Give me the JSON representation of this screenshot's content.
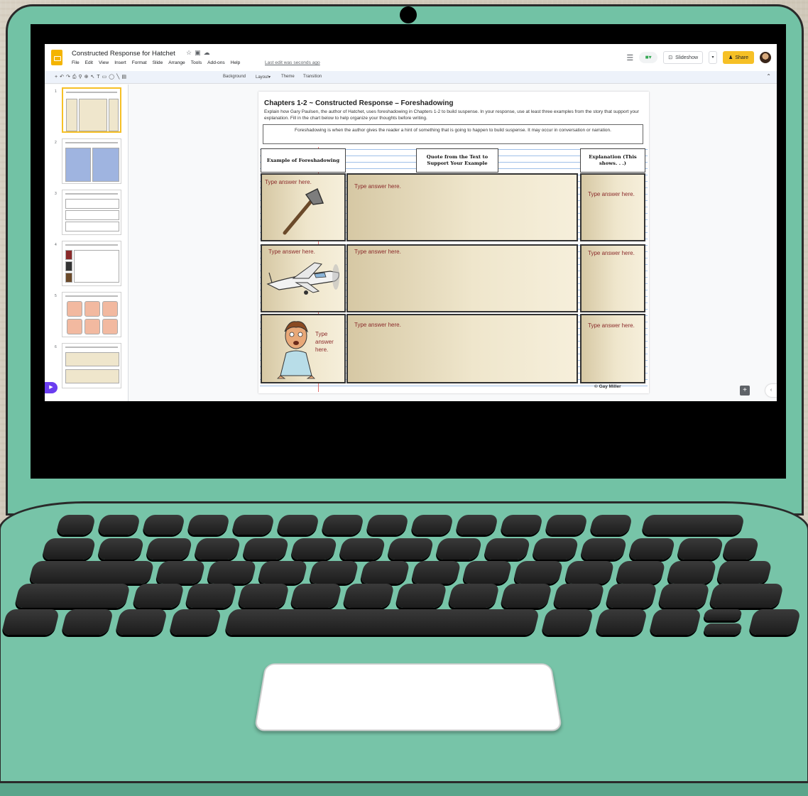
{
  "app": {
    "doc_title": "Constructed Response for Hatchet",
    "menus": [
      "File",
      "Edit",
      "View",
      "Insert",
      "Format",
      "Slide",
      "Arrange",
      "Tools",
      "Add-ons",
      "Help"
    ],
    "last_edit": "Last edit was seconds ago",
    "slideshow_label": "Slideshow",
    "share_label": "Share",
    "colors": {
      "brand": "#f4b400",
      "share": "#f6c026",
      "accent": "#6a3df0"
    }
  },
  "toolbar": {
    "background": "Background",
    "layout": "Layout▾",
    "theme": "Theme",
    "transition": "Transition"
  },
  "filmstrip": {
    "numbers": [
      "1",
      "2",
      "3",
      "4",
      "5",
      "6"
    ]
  },
  "slide": {
    "title": "Chapters 1-2 ~ Constructed Response – Foreshadowing",
    "instructions": "Explain how Gary Paulsen, the author of Hatchet, uses foreshadowing in Chapters 1-2 to build suspense. In your response, use at least three examples from the story that support your explanation. Fill in the chart below to help organize your thoughts before writing.",
    "definition": "Foreshadowing is when the author gives the reader a hint of something that is going to happen to build suspense. It may occur in conversation or narration.",
    "headers": {
      "col1": "Example of Foreshadowing",
      "col2": "Quote from the Text to Support Your Example",
      "col3": "Explanation (This shows. . .)"
    },
    "rows": [
      {
        "example": "Type answer here.",
        "quote": "Type answer  here.",
        "explanation": "Type answer here."
      },
      {
        "example": "Type answer  here.",
        "quote": "Type answer  here.",
        "explanation": "Type answer here."
      },
      {
        "example": "Type answer here.",
        "quote": "Type answer  here.",
        "explanation": "Type answer here."
      }
    ],
    "copyright": "© Gay Miller"
  }
}
